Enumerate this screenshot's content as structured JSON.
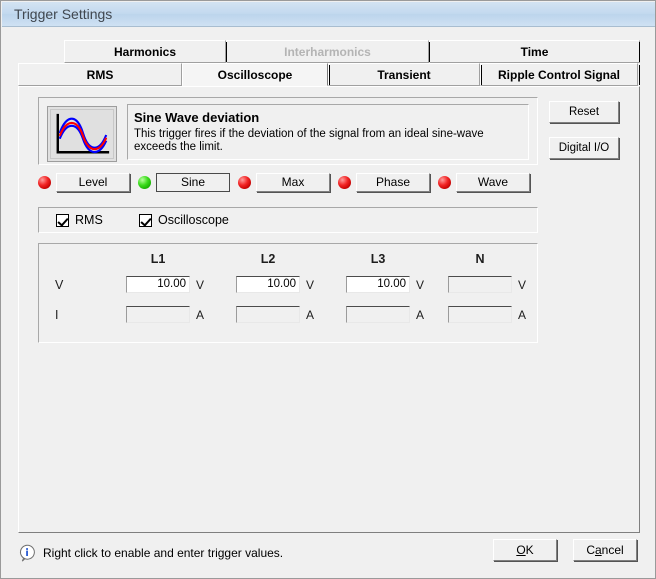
{
  "window": {
    "title": "Trigger Settings"
  },
  "tabs": {
    "row1": [
      {
        "label": "Harmonics",
        "state": "normal"
      },
      {
        "label": "Interharmonics",
        "state": "disabled"
      },
      {
        "label": "Time",
        "state": "normal"
      }
    ],
    "row2": [
      {
        "label": "RMS",
        "state": "normal"
      },
      {
        "label": "Oscilloscope",
        "state": "selected"
      },
      {
        "label": "Transient",
        "state": "normal"
      },
      {
        "label": "Ripple Control Signal",
        "state": "normal"
      }
    ]
  },
  "description": {
    "icon": "sine-wave-deviation-icon",
    "title": "Sine Wave deviation",
    "text": "This trigger fires if the deviation of the signal from an ideal sine-wave exceeds the limit."
  },
  "trigger_buttons": [
    {
      "label": "Level",
      "led": "red",
      "active": false
    },
    {
      "label": "Sine",
      "led": "green",
      "active": true
    },
    {
      "label": "Max",
      "led": "red",
      "active": false
    },
    {
      "label": "Phase",
      "led": "red",
      "active": false
    },
    {
      "label": "Wave",
      "led": "red",
      "active": false
    }
  ],
  "checkboxes": [
    {
      "label": "RMS",
      "checked": true
    },
    {
      "label": "Oscilloscope",
      "checked": true
    }
  ],
  "values_table": {
    "column_headers": [
      "L1",
      "L2",
      "L3",
      "N"
    ],
    "rows": [
      {
        "label": "V",
        "unit": "V",
        "cells": [
          {
            "value": "10.00",
            "enabled": true
          },
          {
            "value": "10.00",
            "enabled": true
          },
          {
            "value": "10.00",
            "enabled": true
          },
          {
            "value": "",
            "enabled": false
          }
        ]
      },
      {
        "label": "I",
        "unit": "A",
        "cells": [
          {
            "value": "",
            "enabled": false
          },
          {
            "value": "",
            "enabled": false
          },
          {
            "value": "",
            "enabled": false
          },
          {
            "value": "",
            "enabled": false
          }
        ]
      }
    ]
  },
  "side_buttons": [
    {
      "label": "Reset"
    },
    {
      "label": "Digital I/O"
    }
  ],
  "status": {
    "icon": "info-icon",
    "text": "Right click to enable and enter trigger values."
  },
  "dialog_buttons": [
    {
      "label": "OK",
      "mnemonic_index": 0
    },
    {
      "label": "Cancel",
      "mnemonic_index": 1
    }
  ],
  "colors": {
    "titlebar": "#c3d9ef",
    "face": "#f0f0f0",
    "led_red": "#f22626",
    "led_green": "#3ddc1e",
    "icon_wave_primary": "#ff0000",
    "icon_wave_secondary": "#0000ff",
    "info_blue": "#1b4fd0"
  }
}
